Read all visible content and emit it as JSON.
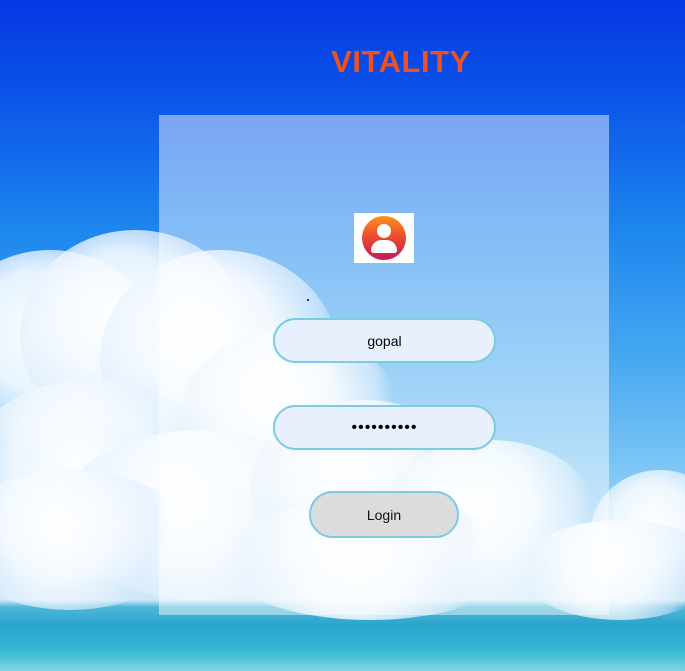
{
  "app": {
    "title": "VITALITY",
    "title_color": "#f0511e"
  },
  "login_form": {
    "avatar_icon": "user-avatar-icon",
    "username_value": "gopal",
    "password_value": "••••••••••",
    "login_label": "Login"
  },
  "colors": {
    "field_background": "#e8f0fe",
    "field_border": "#7ccbe0",
    "button_background": "#dcdcdc"
  }
}
